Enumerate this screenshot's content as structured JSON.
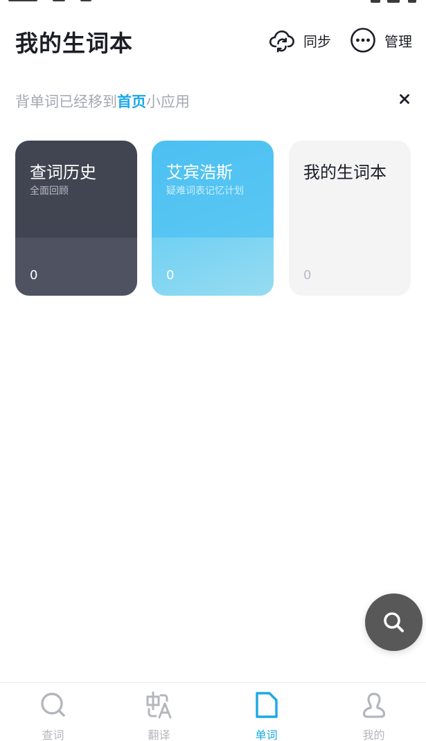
{
  "header": {
    "title": "我的生词本",
    "sync_label": "同步",
    "manage_label": "管理"
  },
  "notice": {
    "text_before": "背单词已经移到",
    "text_link": "首页",
    "text_after": "小应用"
  },
  "cards": [
    {
      "title": "查词历史",
      "subtitle": "全面回顾",
      "count": "0"
    },
    {
      "title": "艾宾浩斯",
      "subtitle": "疑难词表记忆计划",
      "count": "0"
    },
    {
      "title": "我的生词本",
      "subtitle": "",
      "count": "0"
    }
  ],
  "tabs": [
    {
      "label": "查词",
      "icon": "search-icon",
      "active": false
    },
    {
      "label": "翻译",
      "icon": "translate-icon",
      "active": false
    },
    {
      "label": "单词",
      "icon": "document-icon",
      "active": true
    },
    {
      "label": "我的",
      "icon": "person-icon",
      "active": false
    }
  ],
  "colors": {
    "accent": "#1aa9e6",
    "dark_card": "#414552",
    "blue_card": "#4cc0f2",
    "light_card": "#f4f4f5",
    "fab": "#585858"
  }
}
